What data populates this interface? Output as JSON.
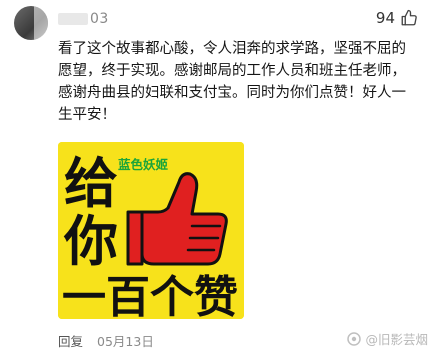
{
  "comment": {
    "username_visible": "03",
    "likes": "94",
    "text": "看了这个故事都心酸，令人泪奔的求学路，坚强不屈的愿望，终于实现。感谢邮局的工作人员和班主任老师，感谢舟曲县的妇联和支付宝。同时为你们点赞！好人一生平安！",
    "sticker": {
      "label": "蓝色妖姬",
      "chars_left": [
        "给",
        "你"
      ],
      "bottom_text": "一百个赞",
      "background": "#f7e21b",
      "accent": "#e02020",
      "label_color": "#1aa53a"
    },
    "reply_label": "回复",
    "date": "05月13日"
  },
  "watermark": {
    "text": "@旧影芸烟"
  }
}
